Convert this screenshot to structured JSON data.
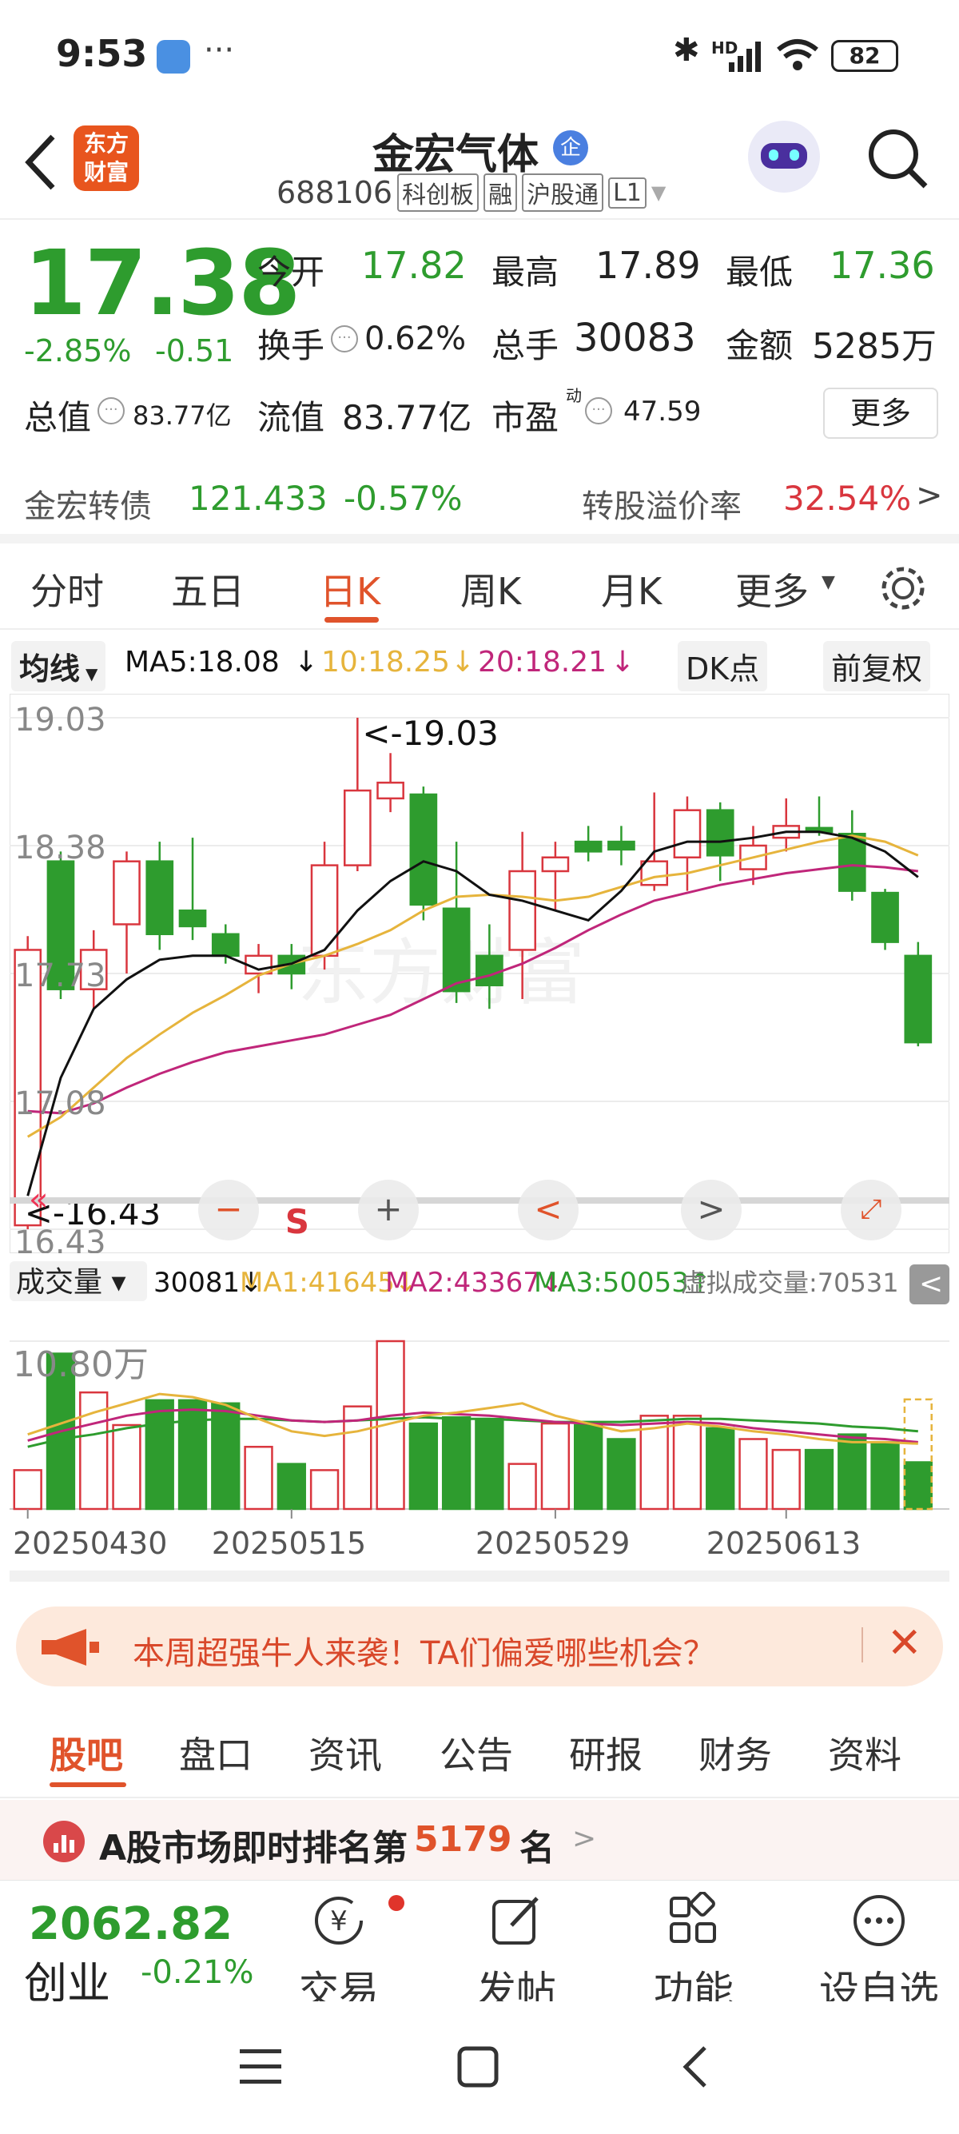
{
  "status_bar": {
    "time": "9:53",
    "battery": "82",
    "network": "HD"
  },
  "header": {
    "logo_text": "东方财富",
    "stock_name": "金宏气体",
    "badge": "企",
    "code": "688106",
    "tags": [
      "科创板",
      "融",
      "沪股通",
      "L1"
    ]
  },
  "quote": {
    "price": "17.38",
    "change_pct": "-2.85%",
    "change": "-0.51",
    "open_label": "今开",
    "open": "17.82",
    "high_label": "最高",
    "high": "17.89",
    "low_label": "最低",
    "low": "17.36",
    "turnover_label": "换手",
    "turnover": "0.62%",
    "volume_label": "总手",
    "volume": "30083",
    "amount_label": "金额",
    "amount": "5285万",
    "mktcap_label": "总值",
    "mktcap": "83.77亿",
    "float_label": "流值",
    "float_cap": "83.77亿",
    "pe_label": "市盈",
    "pe_sup": "动",
    "pe": "47.59",
    "more_label": "更多"
  },
  "bond": {
    "name": "金宏转债",
    "price": "121.433",
    "change_pct": "-0.57%",
    "premium_label": "转股溢价率",
    "premium": "32.54%"
  },
  "period_tabs": [
    "分时",
    "五日",
    "日K",
    "周K",
    "月K",
    "更多"
  ],
  "active_tab": 2,
  "ma_row": {
    "selector": "均线",
    "ma5": "MA5:18.08",
    "ma10": "10:18.25",
    "ma20": "20:18.21",
    "dk": "DK点",
    "adjust": "前复权"
  },
  "chart_colors": {
    "up": "#d9363e",
    "down": "#2e9c2e",
    "ma5": "#111111",
    "ma10": "#e6b43c",
    "ma20": "#c0267a"
  },
  "chart_data": {
    "type": "candlestick",
    "price_axis": [
      "19.03",
      "18.38",
      "17.73",
      "17.08",
      "16.43"
    ],
    "ylim": [
      16.43,
      19.03
    ],
    "high_marker": "<-19.03",
    "low_marker": "<-16.43",
    "sell_marker": "S",
    "candles": [
      {
        "o": 16.45,
        "h": 17.92,
        "l": 16.43,
        "c": 17.85
      },
      {
        "o": 18.3,
        "h": 18.35,
        "l": 17.6,
        "c": 17.65
      },
      {
        "o": 17.65,
        "h": 17.95,
        "l": 17.55,
        "c": 17.85
      },
      {
        "o": 17.98,
        "h": 18.35,
        "l": 17.73,
        "c": 18.3
      },
      {
        "o": 18.3,
        "h": 18.4,
        "l": 17.85,
        "c": 17.93
      },
      {
        "o": 18.05,
        "h": 18.42,
        "l": 17.9,
        "c": 17.97
      },
      {
        "o": 17.93,
        "h": 17.98,
        "l": 17.78,
        "c": 17.82
      },
      {
        "o": 17.73,
        "h": 17.88,
        "l": 17.63,
        "c": 17.82
      },
      {
        "o": 17.82,
        "h": 17.88,
        "l": 17.65,
        "c": 17.73
      },
      {
        "o": 17.82,
        "h": 18.4,
        "l": 17.75,
        "c": 18.28
      },
      {
        "o": 18.28,
        "h": 19.03,
        "l": 18.25,
        "c": 18.66
      },
      {
        "o": 18.62,
        "h": 18.85,
        "l": 18.55,
        "c": 18.7
      },
      {
        "o": 18.64,
        "h": 18.68,
        "l": 18.0,
        "c": 18.08
      },
      {
        "o": 18.06,
        "h": 18.4,
        "l": 17.58,
        "c": 17.64
      },
      {
        "o": 17.82,
        "h": 17.98,
        "l": 17.55,
        "c": 17.67
      },
      {
        "o": 17.85,
        "h": 18.45,
        "l": 17.6,
        "c": 18.25
      },
      {
        "o": 18.25,
        "h": 18.4,
        "l": 18.05,
        "c": 18.32
      },
      {
        "o": 18.4,
        "h": 18.48,
        "l": 18.3,
        "c": 18.35
      },
      {
        "o": 18.4,
        "h": 18.48,
        "l": 18.28,
        "c": 18.36
      },
      {
        "o": 18.18,
        "h": 18.65,
        "l": 18.15,
        "c": 18.3
      },
      {
        "o": 18.32,
        "h": 18.63,
        "l": 18.15,
        "c": 18.56
      },
      {
        "o": 18.56,
        "h": 18.6,
        "l": 18.2,
        "c": 18.33
      },
      {
        "o": 18.26,
        "h": 18.48,
        "l": 18.18,
        "c": 18.38
      },
      {
        "o": 18.42,
        "h": 18.62,
        "l": 18.35,
        "c": 18.48
      },
      {
        "o": 18.47,
        "h": 18.63,
        "l": 18.43,
        "c": 18.45
      },
      {
        "o": 18.44,
        "h": 18.56,
        "l": 18.1,
        "c": 18.15
      },
      {
        "o": 18.14,
        "h": 18.16,
        "l": 17.85,
        "c": 17.89
      },
      {
        "o": 17.82,
        "h": 17.89,
        "l": 17.36,
        "c": 17.38
      }
    ],
    "ma5": [
      16.6,
      17.2,
      17.55,
      17.7,
      17.8,
      17.82,
      17.82,
      17.75,
      17.78,
      17.85,
      18.05,
      18.2,
      18.3,
      18.25,
      18.13,
      18.1,
      18.05,
      18.0,
      18.15,
      18.35,
      18.4,
      18.4,
      18.42,
      18.45,
      18.45,
      18.42,
      18.35,
      18.22
    ],
    "ma10": [
      16.9,
      17.0,
      17.15,
      17.3,
      17.42,
      17.53,
      17.62,
      17.72,
      17.78,
      17.82,
      17.88,
      17.95,
      18.05,
      18.12,
      18.13,
      18.12,
      18.1,
      18.12,
      18.17,
      18.22,
      18.24,
      18.28,
      18.32,
      18.36,
      18.4,
      18.43,
      18.4,
      18.33
    ],
    "ma20": [
      17.03,
      17.02,
      17.07,
      17.15,
      17.22,
      17.28,
      17.33,
      17.36,
      17.39,
      17.42,
      17.47,
      17.52,
      17.6,
      17.68,
      17.72,
      17.78,
      17.86,
      17.95,
      18.03,
      18.1,
      18.14,
      18.18,
      18.21,
      18.24,
      18.26,
      18.28,
      18.27,
      18.25
    ],
    "volume_title": "成交量",
    "volume_value": "30081",
    "vol_ma1": "MA1:41645",
    "vol_ma2": "MA2:43367",
    "vol_ma3": "MA3:50053",
    "virtual_volume": "虚拟成交量:70531",
    "vol_axis_max_label": "10.80万",
    "vol_max": 108000,
    "volumes": [
      25000,
      100000,
      75000,
      54000,
      70000,
      70000,
      68000,
      40000,
      29000,
      25000,
      66000,
      108000,
      55000,
      59000,
      58000,
      29000,
      55000,
      54000,
      45000,
      60000,
      60000,
      52000,
      45000,
      38000,
      38000,
      48000,
      43000,
      30081
    ],
    "virtual_vol": 70531,
    "vol_ma1_line": [
      48000,
      55000,
      62000,
      68000,
      74000,
      72000,
      67000,
      58000,
      50000,
      47000,
      50000,
      55000,
      60000,
      62000,
      65000,
      68000,
      60000,
      55000,
      50000,
      52000,
      55000,
      53000,
      50000,
      48000,
      45000,
      43000,
      43000,
      42000
    ],
    "vol_ma2_line": [
      44000,
      50000,
      55000,
      60000,
      63000,
      64000,
      63000,
      60000,
      57000,
      56000,
      57000,
      60000,
      62000,
      61000,
      60000,
      58000,
      56000,
      55000,
      54000,
      55000,
      56000,
      55000,
      52000,
      50000,
      48000,
      46000,
      45000,
      43000
    ],
    "vol_ma3_line": [
      40000,
      45000,
      48000,
      52000,
      55000,
      57000,
      58000,
      58000,
      57000,
      56000,
      57000,
      58000,
      59000,
      58000,
      58000,
      57000,
      56000,
      56000,
      56000,
      57000,
      58000,
      58000,
      57000,
      56000,
      55000,
      53000,
      52000,
      50000
    ],
    "dates": [
      "20250430",
      "20250515",
      "20250529",
      "20250613"
    ]
  },
  "banner": {
    "text": "本周超强牛人来袭！TA们偏爱哪些机会？"
  },
  "bottom_tabs": [
    "股吧",
    "盘口",
    "资讯",
    "公告",
    "研报",
    "财务",
    "资料"
  ],
  "rank": {
    "prefix": "A股市场即时排名第",
    "number": "5179",
    "suffix": "名"
  },
  "index_ticker": {
    "value": "2062.82",
    "name": "创业",
    "change": "-0.21%"
  },
  "bottom_bar": [
    {
      "label": "交易",
      "icon": "yen-trade-icon"
    },
    {
      "label": "发帖",
      "icon": "edit-post-icon"
    },
    {
      "label": "功能",
      "icon": "grid-function-icon"
    },
    {
      "label": "设自选",
      "icon": "add-favorite-icon"
    }
  ]
}
